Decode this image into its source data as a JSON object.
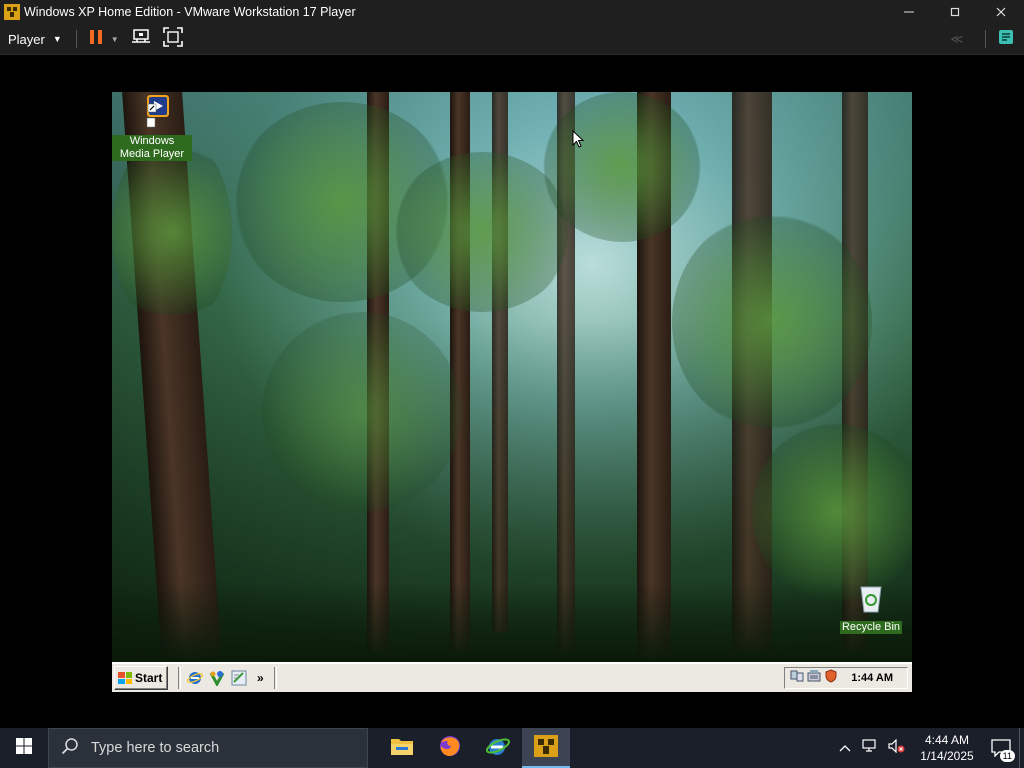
{
  "window": {
    "title": "Windows XP Home Edition - VMware Workstation 17 Player",
    "minimize_icon": "minimize-icon",
    "maximize_icon": "maximize-icon",
    "close_icon": "close-icon"
  },
  "toolbar": {
    "player_label": "Player",
    "icons": [
      "pause-icon",
      "send-ctrl-alt-del-icon",
      "fullscreen-icon",
      "back-icon",
      "notes-icon"
    ]
  },
  "guest": {
    "desktop_icons": [
      {
        "label": "Windows Media Player",
        "icon": "media-player-icon"
      },
      {
        "label": "Recycle Bin",
        "icon": "recycle-bin-icon"
      }
    ],
    "taskbar": {
      "start_label": "Start",
      "quick_launch": [
        "internet-explorer-icon",
        "messenger-icon",
        "notepad-icon"
      ],
      "overflow": "»",
      "clock": "1:44 AM"
    }
  },
  "host_taskbar": {
    "search_placeholder": "Type here to search",
    "apps": [
      "file-explorer-icon",
      "firefox-icon",
      "edge-ie-icon",
      "vmware-player-icon"
    ],
    "time": "4:44 AM",
    "date": "1/14/2025",
    "notification_count": "11"
  },
  "colors": {
    "vm_chrome": "#1f1f1f",
    "pause_accent": "#f26a22",
    "notes_accent": "#3bbfb1",
    "xp_taskbar": "#ece9e3",
    "host_taskbar": "#1a1f29",
    "selection_green": "#2f6b1f"
  }
}
